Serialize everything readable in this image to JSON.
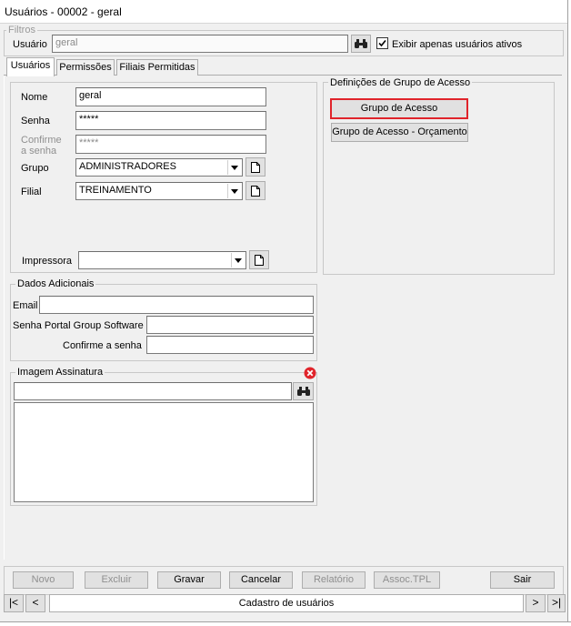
{
  "window": {
    "title": "Usuários - 00002 - geral"
  },
  "filters": {
    "legend": "Filtros",
    "user_label": "Usuário",
    "user_value": "geral",
    "only_active_label": "Exibir apenas usuários ativos",
    "only_active_checked": true
  },
  "tabs": [
    {
      "label": "Usuários",
      "active": true
    },
    {
      "label": "Permissões",
      "active": false
    },
    {
      "label": "Filiais Permitidas",
      "active": false
    }
  ],
  "form": {
    "nome_label": "Nome",
    "nome_value": "geral",
    "senha_label": "Senha",
    "senha_value": "*****",
    "confirme_label_1": "Confirme",
    "confirme_label_2": "a senha",
    "confirme_value": "*****",
    "grupo_label": "Grupo",
    "grupo_value": "ADMINISTRADORES",
    "filial_label": "Filial",
    "filial_value": "TREINAMENTO",
    "impressora_label": "Impressora",
    "impressora_value": ""
  },
  "access_group": {
    "legend": "Definições de Grupo de Acesso",
    "btn_grupo": "Grupo de Acesso",
    "btn_orcamento": "Grupo de Acesso - Orçamento",
    "highlight_color": "#e0242b"
  },
  "additional": {
    "legend": "Dados Adicionais",
    "email_label": "Email",
    "email_value": "",
    "portal_label": "Senha Portal Group Software",
    "portal_value": "",
    "confirm_label": "Confirme a senha",
    "confirm_value": ""
  },
  "signature": {
    "legend": "Imagem Assinatura",
    "path_value": "",
    "clear_icon_color": "#e0242b"
  },
  "toolbar": {
    "novo": "Novo",
    "excluir": "Excluir",
    "gravar": "Gravar",
    "cancelar": "Cancelar",
    "relatorio": "Relatório",
    "assoc": "Assoc.TPL",
    "sair": "Sair"
  },
  "nav": {
    "first": "|<",
    "prev": "<",
    "status": "Cadastro de usuários",
    "next": ">",
    "last": ">|"
  }
}
